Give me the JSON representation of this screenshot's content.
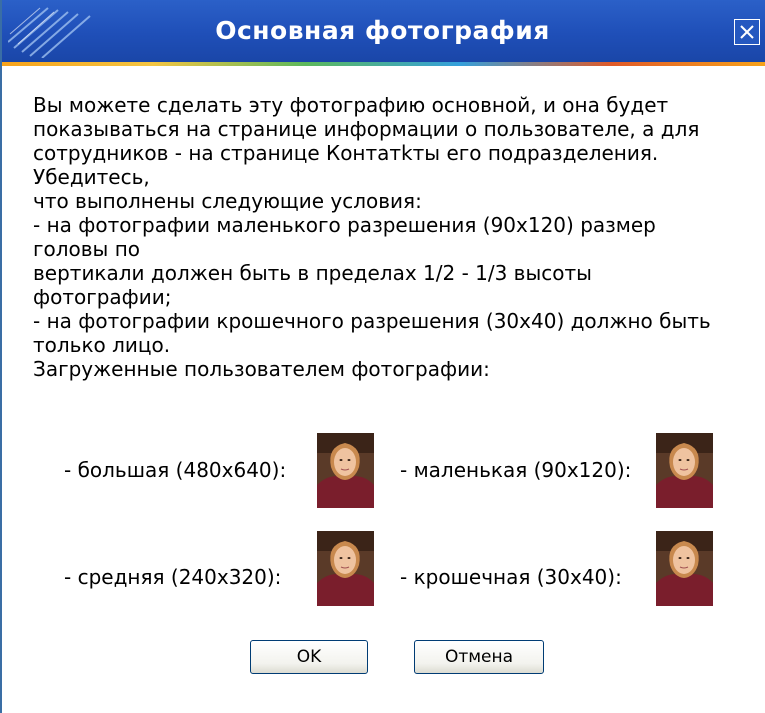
{
  "dialog": {
    "title": "Основная фотография",
    "close_icon": "close-icon"
  },
  "message": {
    "lines": [
      "Вы можете сделать эту фотографию основной, и она будет",
      "показываться на странице информации о пользователе, а для",
      "сотрудников - на странице Контатkты его подразделения.",
      "Убедитесь,",
      "что выполнены следующие условия:",
      "- на фотографии маленького разрешения (90x120) размер",
      "головы по",
      "вертикали должен быть в пределах 1/2 - 1/3 высоты",
      "фотографии;",
      "- на фотографии крошечного разрешения (30x40) должно быть",
      "только лицо.",
      "Загруженные пользователем фотографии:"
    ]
  },
  "photos": {
    "large_label": "- большая (480x640):",
    "small_label": "- маленькая (90x120):",
    "medium_label": "- средняя (240x320):",
    "tiny_label": "- крошечная (30x40):"
  },
  "buttons": {
    "ok_label": "OK",
    "cancel_label": "Отмена"
  },
  "colors": {
    "titlebar": "#1f4fb8",
    "title_text": "#ffffff",
    "accent": "#f7a21a"
  }
}
